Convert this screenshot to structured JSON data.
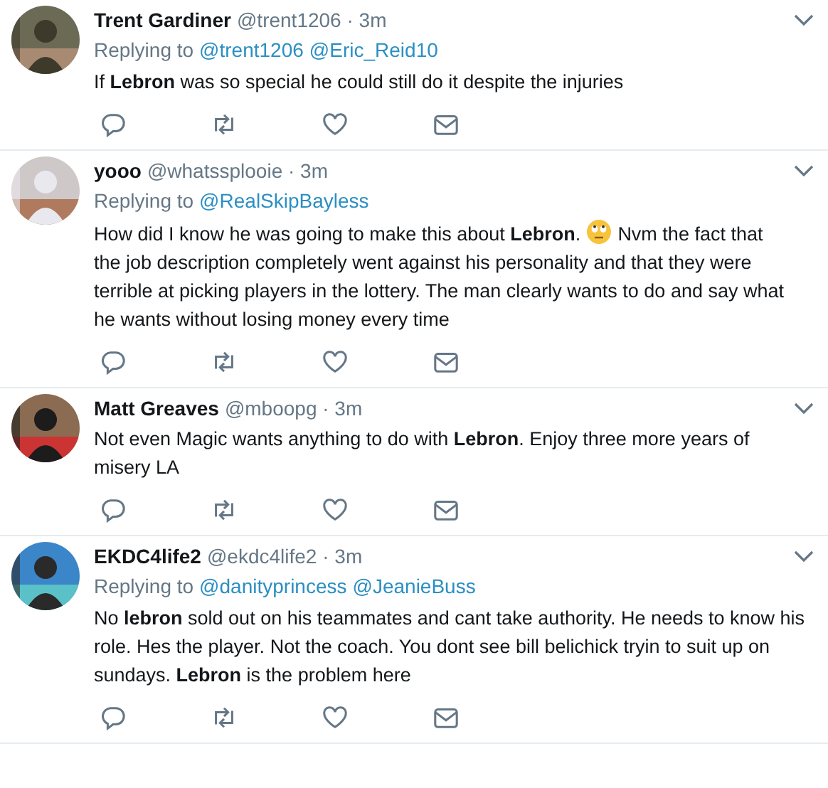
{
  "tweets": [
    {
      "name": "Trent Gardiner",
      "handle": "@trent1206 · 3m",
      "replying_label": "Replying to",
      "replying_to": [
        "@trent1206",
        "@Eric_Reid10"
      ],
      "avatar": {
        "kind": "picture"
      },
      "body": [
        {
          "kind": "text",
          "text": "If **Lebron** was so special he could still do it despite the injuries"
        }
      ]
    },
    {
      "name": "yooo",
      "handle": "@whatssplooie · 3m",
      "replying_label": "Replying to",
      "replying_to": [
        "@RealSkipBayless"
      ],
      "avatar": {
        "kind": "picture"
      },
      "body": [
        {
          "kind": "line",
          "text": "How did I know he was going to make this about **Lebron**."
        },
        {
          "kind": "emoji"
        },
        {
          "kind": "line",
          "text": "Nvm the fact that"
        },
        {
          "kind": "text",
          "text": "the job description completely went against his personality and that they were terrible at picking players in the lottery. The man clearly wants to do and say what he wants without losing money every time"
        }
      ]
    },
    {
      "name": "Matt Greaves",
      "handle": "@mboopg · 3m",
      "avatar": {
        "kind": "picture"
      },
      "body": [
        {
          "kind": "text",
          "text": "Not even Magic wants anything to do with **Lebron**.  Enjoy three more years of misery LA"
        }
      ]
    },
    {
      "name": "EKDC4life2",
      "handle": "@ekdc4life2 · 3m",
      "replying_label": "Replying to",
      "replying_to": [
        "@danityprincess",
        "@JeanieBuss"
      ],
      "avatar": {
        "kind": "picture"
      },
      "body": [
        {
          "kind": "text",
          "text": "No **lebron** sold out on his teammates and cant take authority. He needs to know his role. Hes the player. Not the coach. You dont see bill belichick tryin to suit up on sundays. **Lebron** is the problem here"
        }
      ]
    }
  ]
}
